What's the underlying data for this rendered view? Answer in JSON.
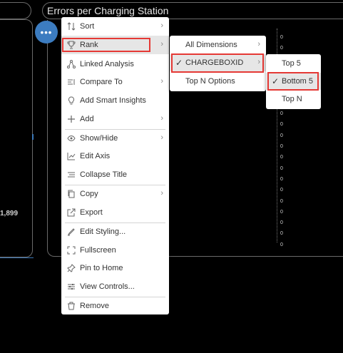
{
  "chart": {
    "title": "Errors per Charging Station",
    "left_value": "1,899",
    "zero_labels": [
      "0",
      "0",
      "0",
      "0",
      "0",
      "0",
      "0",
      "0",
      "0",
      "0",
      "0",
      "0",
      "0",
      "0",
      "0",
      "0",
      "0",
      "0",
      "0",
      "0"
    ]
  },
  "more_button": {
    "label": "•••"
  },
  "main_menu": {
    "items": [
      {
        "label": "Sort",
        "icon": "sort-icon",
        "chevron": "›"
      },
      {
        "label": "Rank",
        "icon": "trophy-icon",
        "chevron": "›"
      },
      {
        "label": "Linked Analysis",
        "icon": "linked-analysis-icon"
      },
      {
        "label": "Compare To",
        "icon": "compare-icon",
        "chevron": "›"
      },
      {
        "label": "Add Smart Insights",
        "icon": "lightbulb-icon"
      },
      {
        "label": "Add",
        "icon": "plus-icon",
        "chevron": "›"
      },
      {
        "label": "Show/Hide",
        "icon": "eye-icon",
        "chevron": "›"
      },
      {
        "label": "Edit Axis",
        "icon": "axis-icon"
      },
      {
        "label": "Collapse Title",
        "icon": "collapse-title-icon"
      },
      {
        "label": "Copy",
        "icon": "copy-icon",
        "chevron": "›"
      },
      {
        "label": "Export",
        "icon": "export-icon"
      },
      {
        "label": "Edit Styling...",
        "icon": "paint-icon"
      },
      {
        "label": "Fullscreen",
        "icon": "fullscreen-icon"
      },
      {
        "label": "Pin to Home",
        "icon": "pin-icon"
      },
      {
        "label": "View Controls...",
        "icon": "sliders-icon"
      },
      {
        "label": "Remove",
        "icon": "trash-icon"
      }
    ]
  },
  "rank_menu": {
    "items": [
      {
        "label": "All Dimensions",
        "chevron": "›"
      },
      {
        "label": "CHARGEBOXID",
        "check": "✓",
        "chevron": "›"
      },
      {
        "label": "Top N Options"
      }
    ]
  },
  "chargebox_menu": {
    "items": [
      {
        "label": "Top 5"
      },
      {
        "label": "Bottom 5",
        "check": "✓"
      },
      {
        "label": "Top N"
      }
    ]
  },
  "colors": {
    "accent": "#3c7cc0",
    "highlight_border": "#e53935"
  }
}
